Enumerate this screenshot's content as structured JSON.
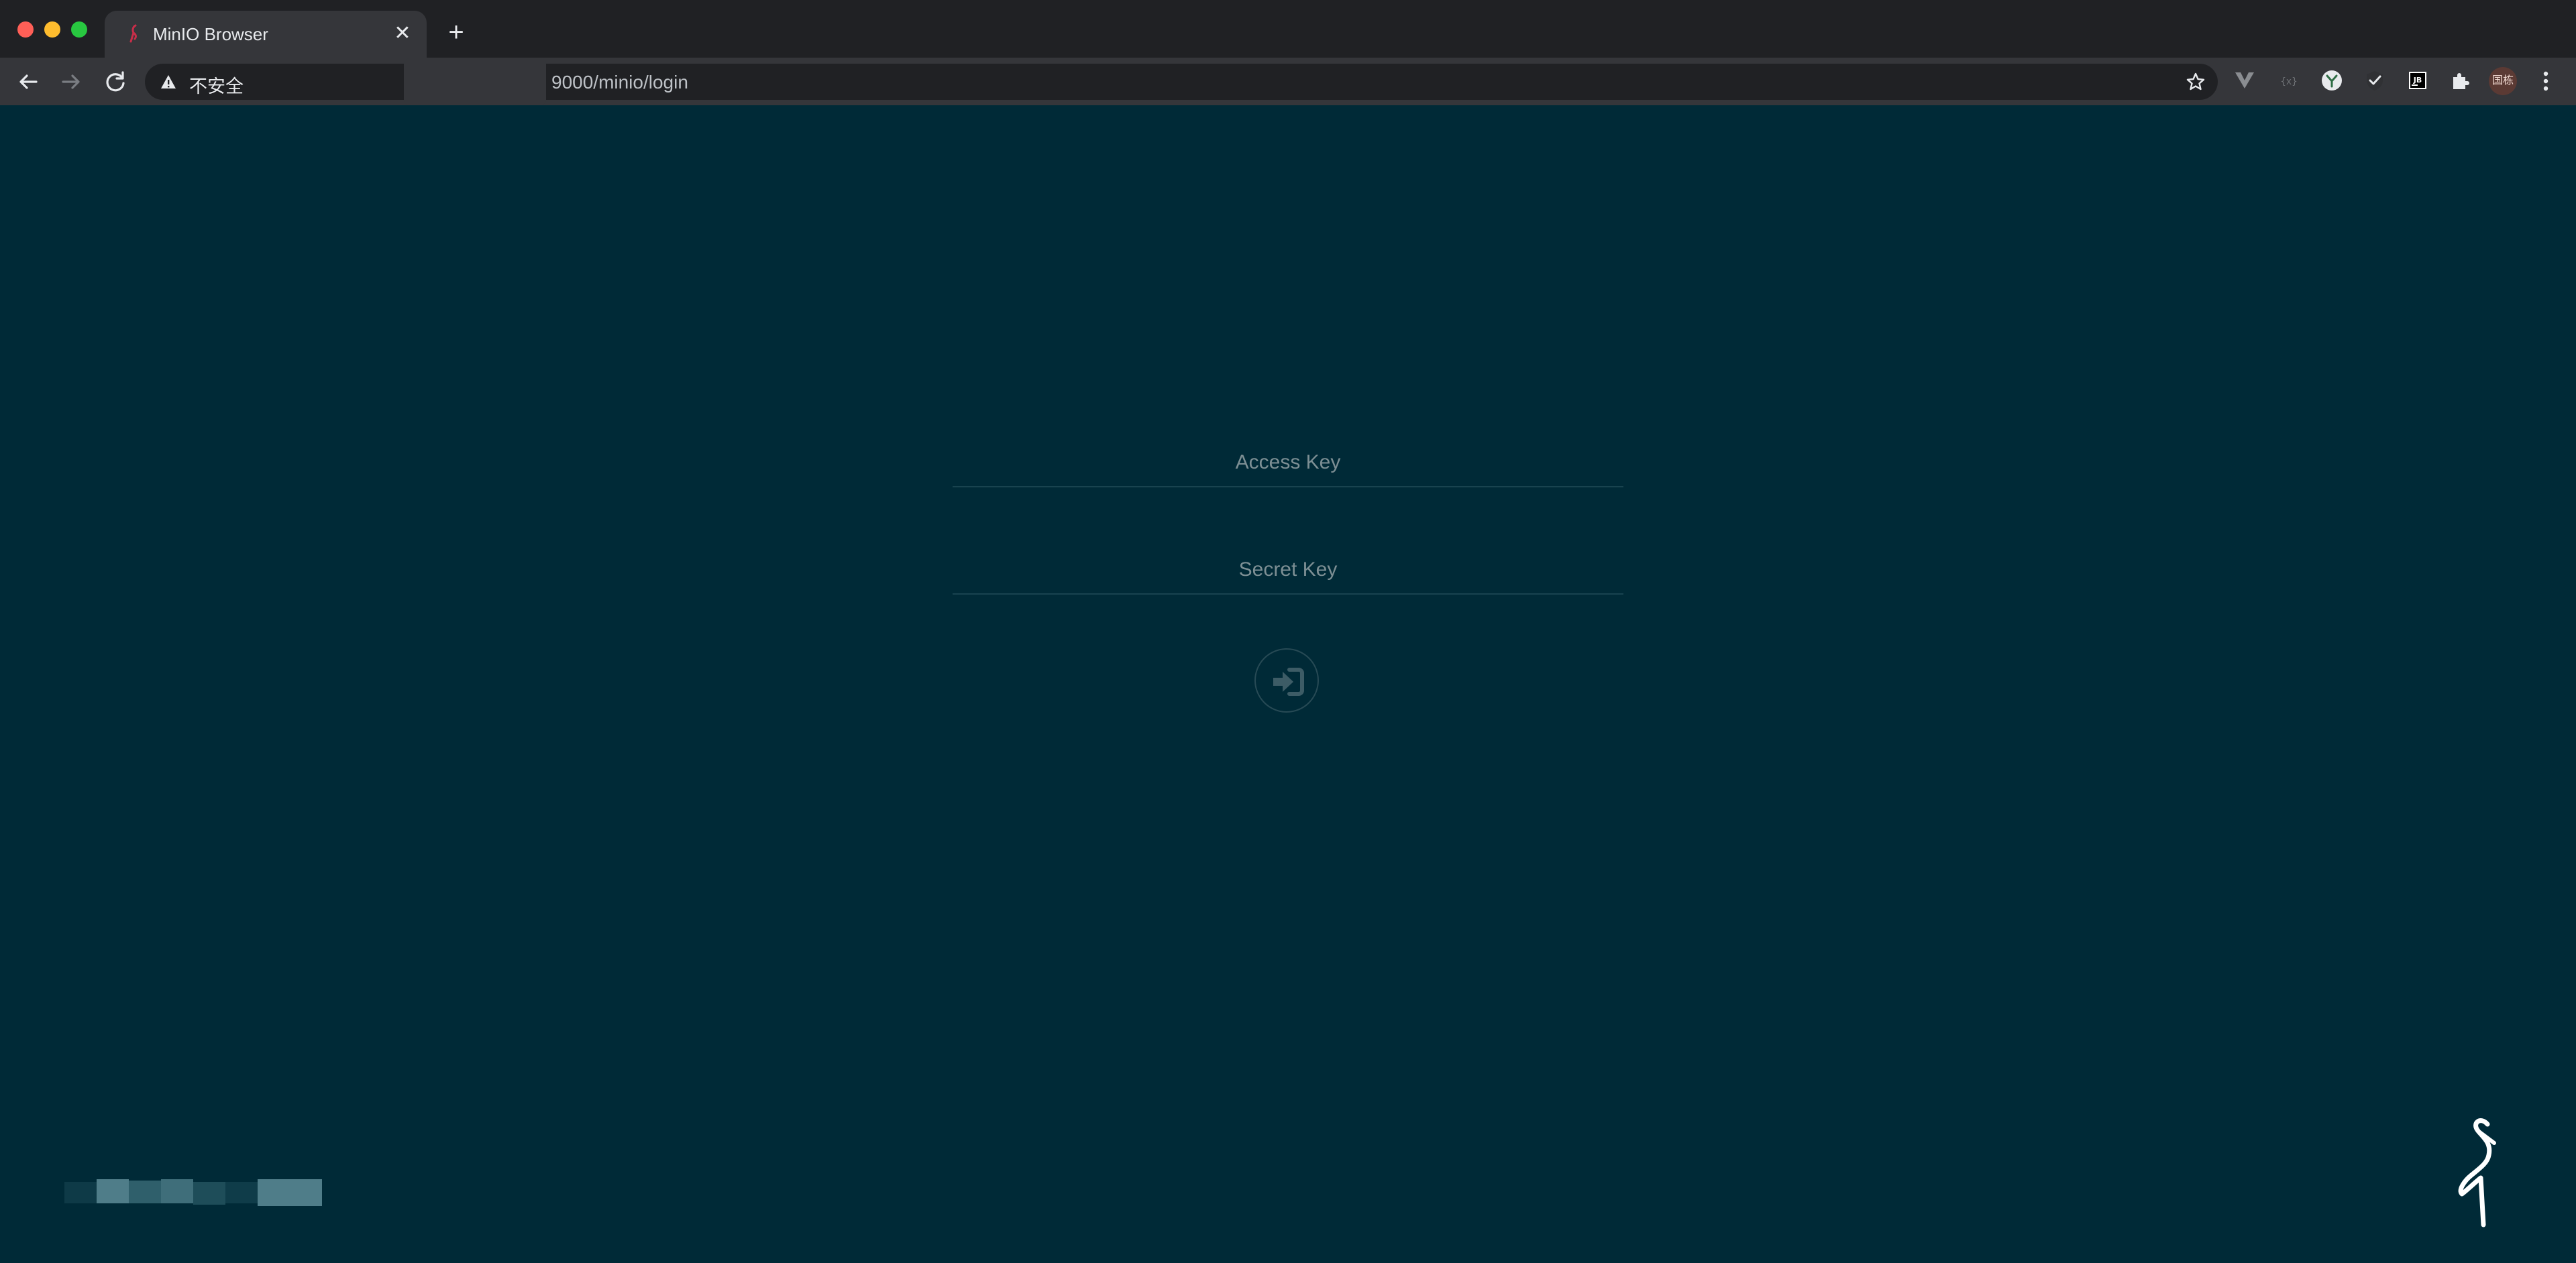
{
  "browser": {
    "tab": {
      "title": "MinIO Browser",
      "close_glyph": "✕"
    },
    "newtab_glyph": "+",
    "omnibox": {
      "security_label": "不安全",
      "url_visible": "9000/minio/login"
    },
    "profile_initials": "国栋"
  },
  "login": {
    "access_key_placeholder": "Access Key",
    "secret_key_placeholder": "Secret Key"
  },
  "icons": {
    "tab_favicon": "minio-favicon",
    "back": "arrow-left-icon",
    "forward": "arrow-right-icon",
    "reload": "reload-icon",
    "warning": "warning-triangle-icon",
    "bookmark": "star-icon",
    "submit": "sign-in-icon",
    "brand": "minio-flamingo-logo"
  },
  "colors": {
    "page_background": "#002a37",
    "chrome_dark": "#202124",
    "chrome_toolbar": "#35363a",
    "field_underline": "#19434f",
    "placeholder": "#7d8f94"
  }
}
